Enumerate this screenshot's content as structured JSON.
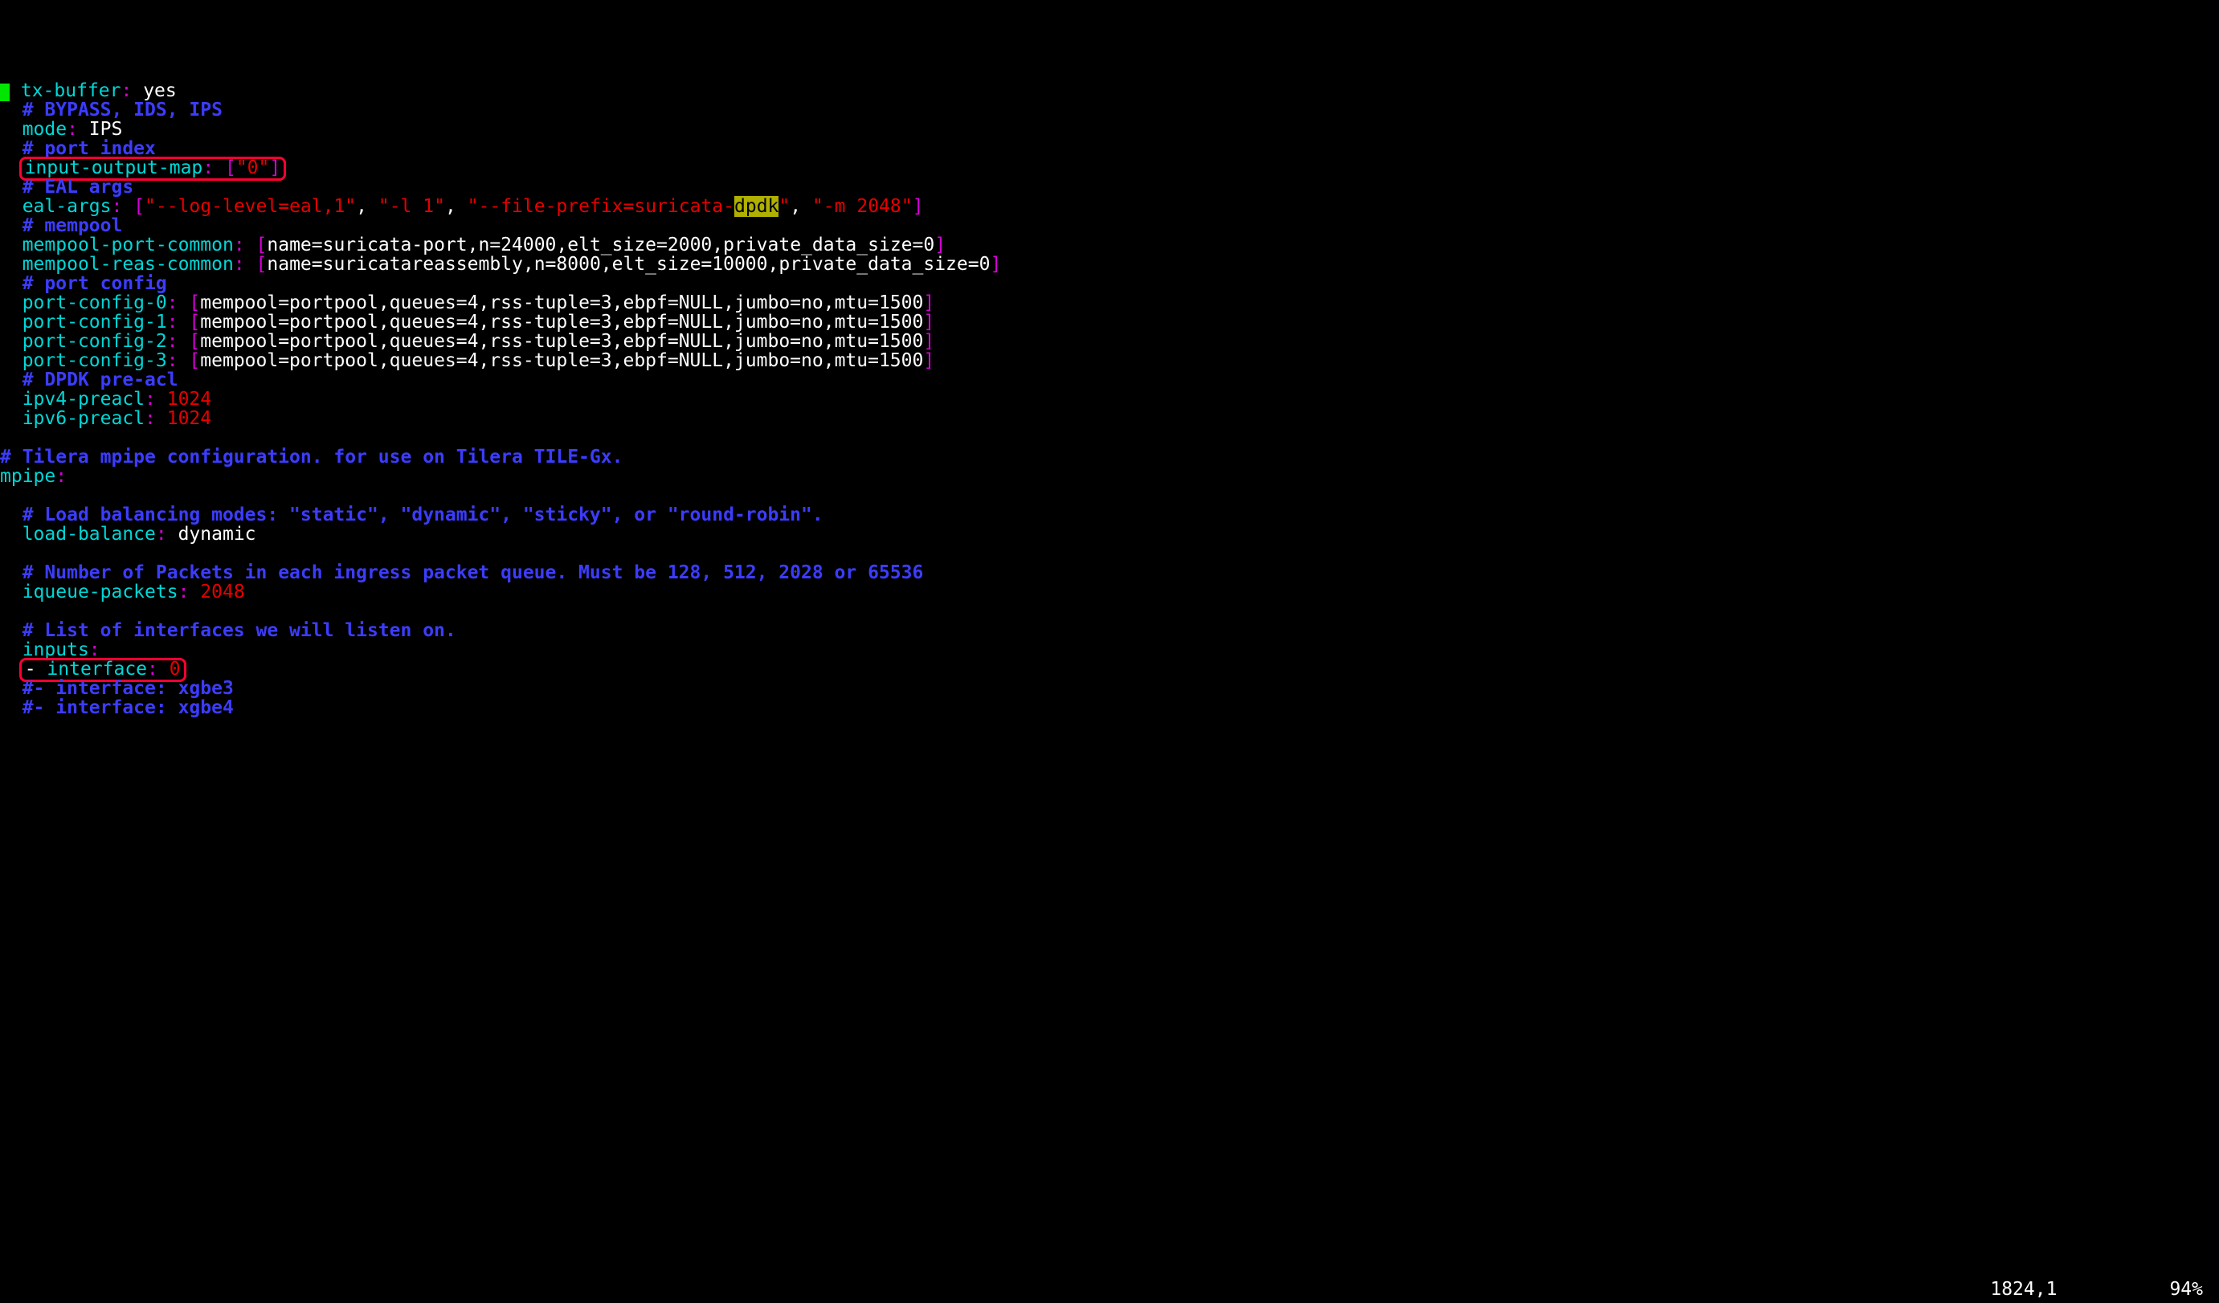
{
  "lines": [
    {
      "i": "  ",
      "k": "tx-buffer",
      "p": ": ",
      "v": "yes",
      "vc": "white",
      "cursor": true
    },
    {
      "i": "  ",
      "comment": "# BYPASS, IDS, IPS"
    },
    {
      "i": "  ",
      "k": "mode",
      "p": ": ",
      "v": "IPS",
      "vc": "white"
    },
    {
      "i": "  ",
      "comment": "# port index"
    },
    {
      "box": true,
      "i": "  ",
      "k": "input-output-map",
      "p": ": ",
      "arr_pre": "[",
      "arr_post": "]",
      "items": [
        {
          "t": "\"0\"",
          "c": "red"
        }
      ]
    },
    {
      "i": "  ",
      "comment": "# EAL args"
    },
    {
      "i": "  ",
      "k": "eal-args",
      "p": ": ",
      "arr_pre": "[",
      "arr_post": "]",
      "items": [
        {
          "t": "\"--log-level=eal,1\"",
          "c": "red"
        },
        {
          "t": ", ",
          "c": "white"
        },
        {
          "t": "\"-l 1\"",
          "c": "red"
        },
        {
          "t": ", ",
          "c": "white"
        },
        {
          "t": "\"--file-prefix=suricata-",
          "c": "red"
        },
        {
          "t": "dpdk",
          "c": "yellow-hl"
        },
        {
          "t": "\"",
          "c": "red"
        },
        {
          "t": ", ",
          "c": "white"
        },
        {
          "t": "\"-m 2048\"",
          "c": "red"
        }
      ]
    },
    {
      "i": "  ",
      "comment": "# mempool"
    },
    {
      "i": "  ",
      "k": "mempool-port-common",
      "p": ": ",
      "arr_pre": "[",
      "arr_post": "]",
      "items": [
        {
          "t": "name=suricata-port,n=24000,elt_size=2000,private_data_size=0",
          "c": "white"
        }
      ]
    },
    {
      "i": "  ",
      "k": "mempool-reas-common",
      "p": ": ",
      "arr_pre": "[",
      "arr_post": "]",
      "items": [
        {
          "t": "name=suricatareassembly,n=8000,elt_size=10000,private_data_size=0",
          "c": "white"
        }
      ]
    },
    {
      "i": "  ",
      "comment": "# port config"
    },
    {
      "i": "  ",
      "k": "port-config-0",
      "p": ": ",
      "arr_pre": "[",
      "arr_post": "]",
      "items": [
        {
          "t": "mempool=portpool,queues=4,rss-tuple=3,ebpf=NULL,jumbo=no,mtu=1500",
          "c": "white"
        }
      ]
    },
    {
      "i": "  ",
      "k": "port-config-1",
      "p": ": ",
      "arr_pre": "[",
      "arr_post": "]",
      "items": [
        {
          "t": "mempool=portpool,queues=4,rss-tuple=3,ebpf=NULL,jumbo=no,mtu=1500",
          "c": "white"
        }
      ]
    },
    {
      "i": "  ",
      "k": "port-config-2",
      "p": ": ",
      "arr_pre": "[",
      "arr_post": "]",
      "items": [
        {
          "t": "mempool=portpool,queues=4,rss-tuple=3,ebpf=NULL,jumbo=no,mtu=1500",
          "c": "white"
        }
      ]
    },
    {
      "i": "  ",
      "k": "port-config-3",
      "p": ": ",
      "arr_pre": "[",
      "arr_post": "]",
      "items": [
        {
          "t": "mempool=portpool,queues=4,rss-tuple=3,ebpf=NULL,jumbo=no,mtu=1500",
          "c": "white"
        }
      ]
    },
    {
      "i": "  ",
      "comment": "# DPDK pre-acl"
    },
    {
      "i": "  ",
      "k": "ipv4-preacl",
      "p": ": ",
      "v": "1024",
      "vc": "red"
    },
    {
      "i": "  ",
      "k": "ipv6-preacl",
      "p": ": ",
      "v": "1024",
      "vc": "red"
    },
    {
      "blank": true
    },
    {
      "i": "",
      "comment": "# Tilera mpipe configuration. for use on Tilera TILE-Gx."
    },
    {
      "i": "",
      "k": "mpipe",
      "p": ":",
      "v": "",
      "vc": "white"
    },
    {
      "blank": true
    },
    {
      "i": "  ",
      "comment": "# Load balancing modes: \"static\", \"dynamic\", \"sticky\", or \"round-robin\"."
    },
    {
      "i": "  ",
      "k": "load-balance",
      "p": ": ",
      "v": "dynamic",
      "vc": "white"
    },
    {
      "blank": true
    },
    {
      "i": "  ",
      "comment": "# Number of Packets in each ingress packet queue. Must be 128, 512, 2028 or 65536"
    },
    {
      "i": "  ",
      "k": "iqueue-packets",
      "p": ": ",
      "v": "2048",
      "vc": "red"
    },
    {
      "blank": true
    },
    {
      "i": "  ",
      "comment": "# List of interfaces we will listen on."
    },
    {
      "i": "  ",
      "k": "inputs",
      "p": ":",
      "v": "",
      "vc": "white"
    },
    {
      "box": true,
      "i": "  ",
      "dash": "- ",
      "k": "interface",
      "p": ": ",
      "v": "0",
      "vc": "red"
    },
    {
      "i": "  ",
      "comment": "#- interface: xgbe3"
    },
    {
      "i": "  ",
      "comment": "#- interface: xgbe4"
    }
  ],
  "status": {
    "pos": "1824,1",
    "pct": "94%"
  }
}
